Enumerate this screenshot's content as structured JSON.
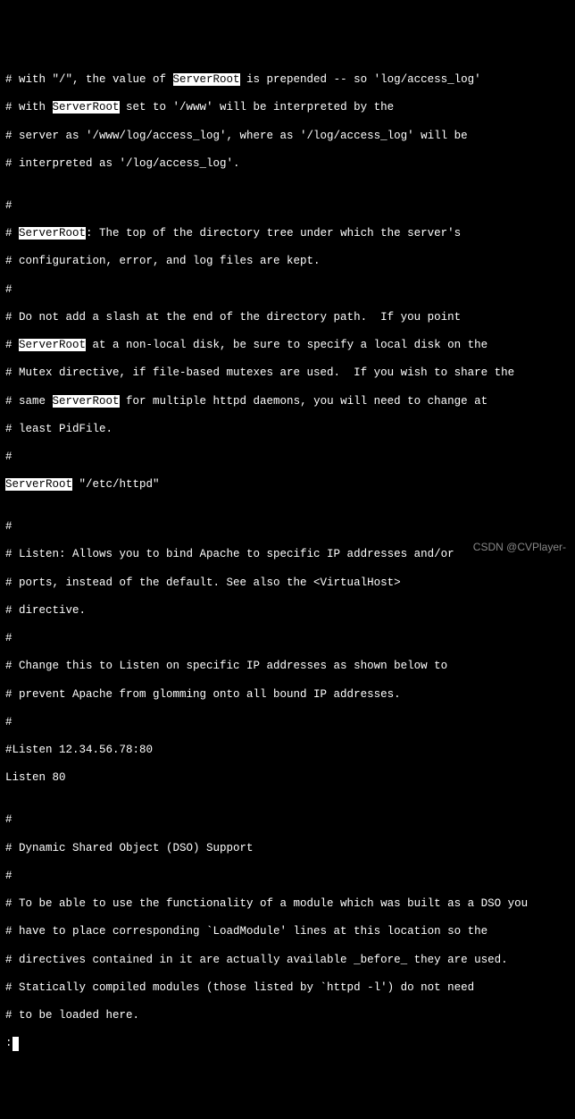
{
  "hl": {
    "serverroot": "ServerRoot"
  },
  "lines": {
    "l0a": "# with \"/\", the value of ",
    "l0b": " is prepended -- so 'log/access_log'",
    "l1a": "# with ",
    "l1b": " set to '/www' will be interpreted by the",
    "l2": "# server as '/www/log/access_log', where as '/log/access_log' will be",
    "l3": "# interpreted as '/log/access_log'.",
    "blank": "",
    "hash": "#",
    "l5a": "# ",
    "l5b": ": The top of the directory tree under which the server's",
    "l6": "# configuration, error, and log files are kept.",
    "l8": "# Do not add a slash at the end of the directory path.  If you point",
    "l9a": "# ",
    "l9b": " at a non-local disk, be sure to specify a local disk on the",
    "l10": "# Mutex directive, if file-based mutexes are used.  If you wish to share the",
    "l11a": "# same ",
    "l11b": " for multiple httpd daemons, you will need to change at",
    "l12": "# least PidFile.",
    "l14a": " \"/etc/httpd\"",
    "l16": "# Listen: Allows you to bind Apache to specific IP addresses and/or",
    "l17": "# ports, instead of the default. See also the <VirtualHost>",
    "l18": "# directive.",
    "l20": "# Change this to Listen on specific IP addresses as shown below to",
    "l21": "# prevent Apache from glomming onto all bound IP addresses.",
    "l23": "#Listen 12.34.56.78:80",
    "l24": "Listen 80",
    "l26": "# Dynamic Shared Object (DSO) Support",
    "l28": "# To be able to use the functionality of a module which was built as a DSO you",
    "l29": "# have to place corresponding `LoadModule' lines at this location so the",
    "l30": "# directives contained in it are actually available _before_ they are used.",
    "l31": "# Statically compiled modules (those listed by `httpd -l') do not need",
    "l32": "# to be loaded here.",
    "prompt": ":"
  },
  "watermark": "CSDN @CVPlayer-"
}
